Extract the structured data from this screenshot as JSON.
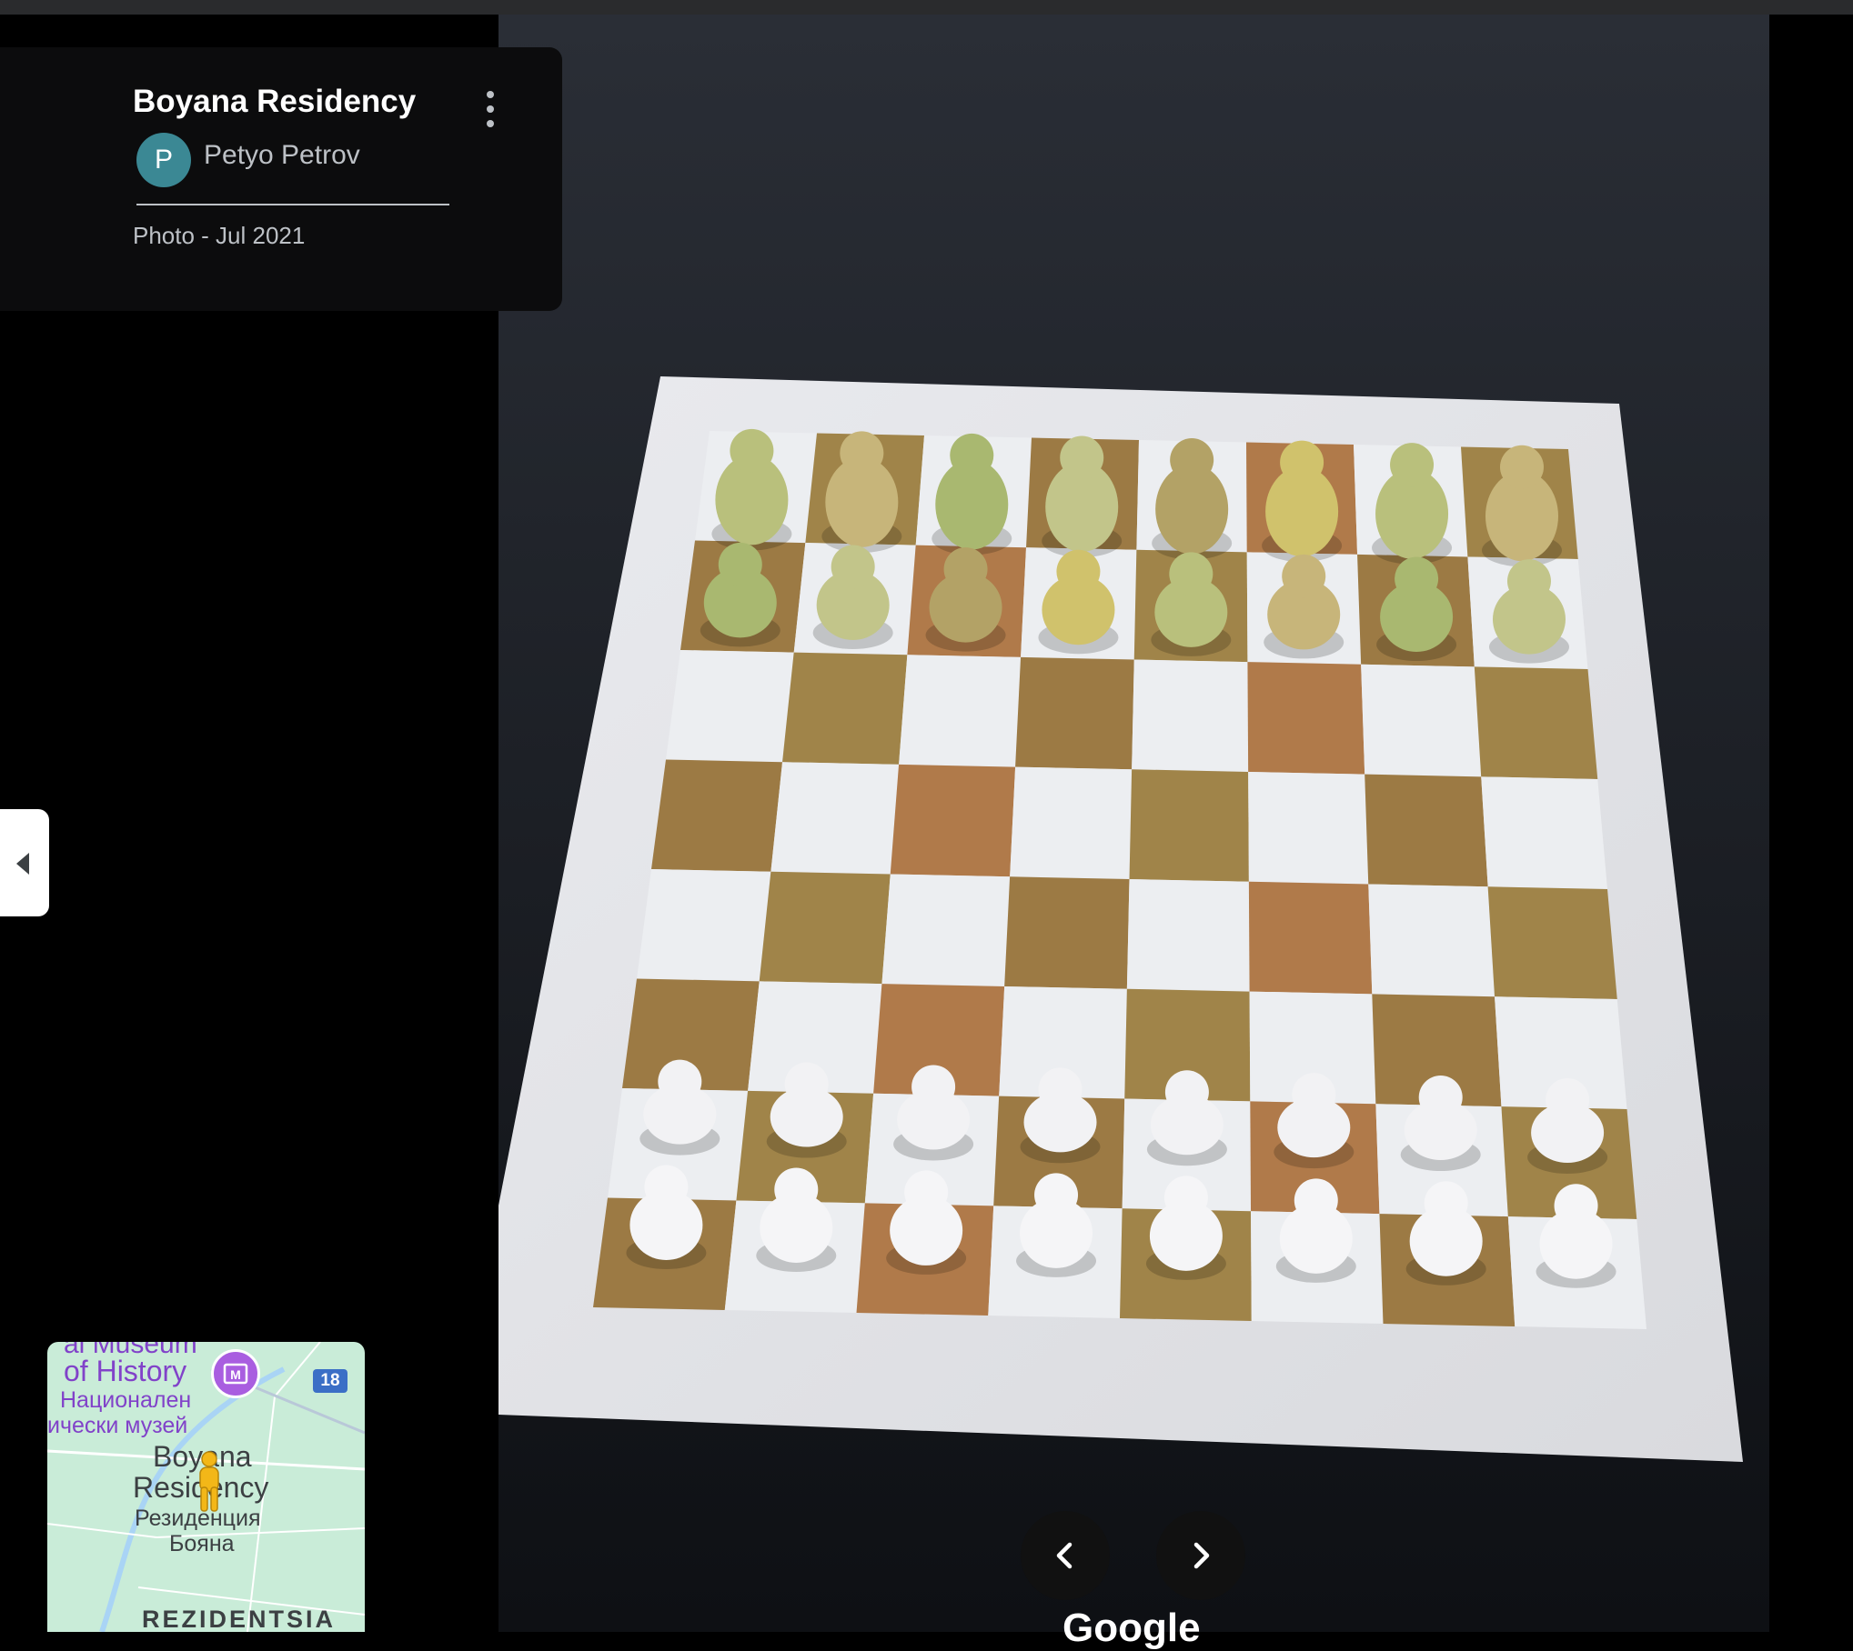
{
  "place": {
    "title": "Boyana Residency",
    "author_initial": "P",
    "author_name": "Petyo Petrov",
    "photo_date": "Photo - Jul 2021"
  },
  "icons": {
    "more": "more-vert-icon",
    "collapse": "chevron-left-icon",
    "prev": "chevron-left-icon",
    "next": "chevron-right-icon",
    "museum": "museum-icon",
    "pegman": "pegman-icon"
  },
  "photo": {
    "subject": "onyx chess set",
    "watermark": "Google"
  },
  "minimap": {
    "label_museum_cut": "al Museum",
    "label_museum": "of History",
    "label_museum_bg1": "Национален",
    "label_museum_bg2": "ически музей",
    "road_number": "18",
    "label_place_1": "Boyana",
    "label_place_2": "Residency",
    "label_place_bg1": "Резиденция",
    "label_place_bg2": "Бояна",
    "label_area": "REZIDENTSIA"
  },
  "colors": {
    "avatar": "#3b8894",
    "map_bg": "#c9ecd8",
    "map_label": "#8142c9"
  }
}
